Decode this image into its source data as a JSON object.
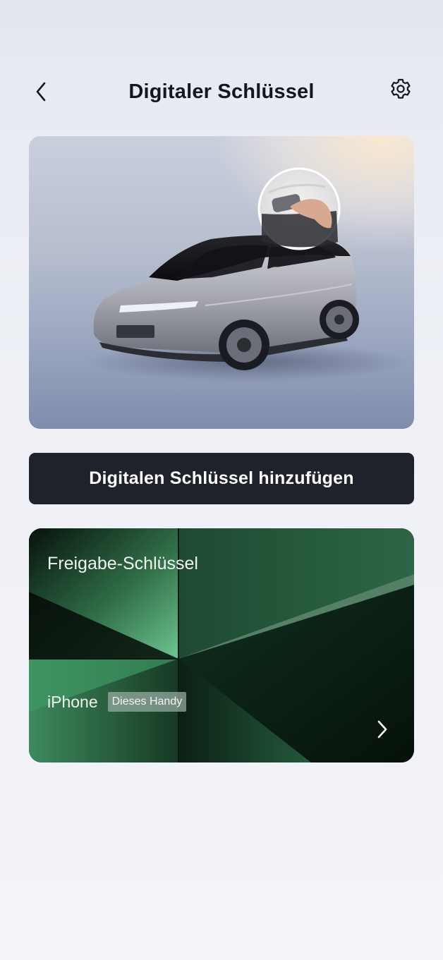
{
  "header": {
    "title": "Digitaler Schlüssel",
    "back_icon": "chevron-left-icon",
    "settings_icon": "gear-icon"
  },
  "hero": {
    "image": "car-with-phone-key-image"
  },
  "actions": {
    "add_key_label": "Digitalen Schlüssel hinzufügen"
  },
  "share_card": {
    "title": "Freigabe-Schlüssel",
    "device_name": "iPhone",
    "device_badge": "Dieses Handy",
    "chevron_icon": "chevron-right-icon"
  },
  "colors": {
    "button_bg": "#1f222a",
    "card_green": "#2e6b48",
    "page_bg": "#eef0f6"
  }
}
